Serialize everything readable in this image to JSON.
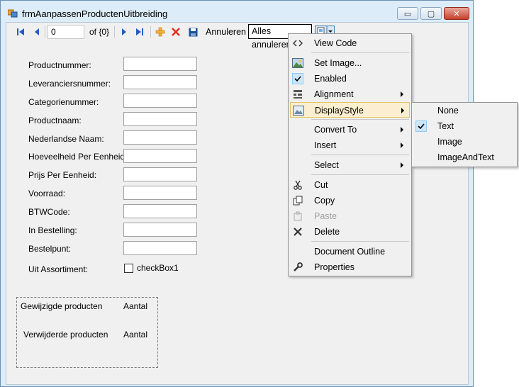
{
  "window": {
    "title": "frmAanpassenProductenUitbreiding",
    "buttons": {
      "minimize": "▭",
      "maximize": "▢",
      "close": "✕"
    }
  },
  "toolstrip": {
    "position_value": "0",
    "count_label": "of {0}",
    "cancel_label": "Annuleren",
    "cancel_all_label": "Alles annuleren",
    "icons": [
      "move-first-icon",
      "move-previous-icon",
      "move-next-icon",
      "move-last-icon",
      "add-new-icon",
      "delete-icon",
      "save-icon",
      "split-button-icon"
    ]
  },
  "form": {
    "fields": [
      {
        "label": "Productnummer:",
        "value": ""
      },
      {
        "label": "Leveranciersnummer:",
        "value": ""
      },
      {
        "label": "Categorienummer:",
        "value": ""
      },
      {
        "label": "Productnaam:",
        "value": ""
      },
      {
        "label": "Nederlandse Naam:",
        "value": ""
      },
      {
        "label": "Hoeveelheid Per Eenheid:",
        "value": ""
      },
      {
        "label": "Prijs Per Eenheid:",
        "value": ""
      },
      {
        "label": "Voorraad:",
        "value": ""
      },
      {
        "label": "BTWCode:",
        "value": ""
      },
      {
        "label": "In Bestelling:",
        "value": ""
      },
      {
        "label": "Bestelpunt:",
        "value": ""
      }
    ],
    "assortiment_label": "Uit Assortiment:",
    "checkbox_label": "checkBox1",
    "checkbox_checked": false
  },
  "groupbox": {
    "row1_label": "Gewijzigde producten",
    "row1_value": "Aantal",
    "row2_label": "Verwijderde producten",
    "row2_value": "Aantal"
  },
  "context_menu": {
    "items": [
      {
        "label": "View Code",
        "icon": "view-code-icon"
      },
      {
        "label": "Set Image...",
        "icon": "image-icon"
      },
      {
        "label": "Enabled",
        "icon": "checkmark-icon",
        "checked": true
      },
      {
        "label": "Alignment",
        "icon": "alignment-icon",
        "submenu": true
      },
      {
        "label": "DisplayStyle",
        "icon": "display-style-icon",
        "submenu": true,
        "highlighted": true
      },
      {
        "label": "Convert To",
        "submenu": true
      },
      {
        "label": "Insert",
        "submenu": true
      },
      {
        "label": "Select",
        "submenu": true
      },
      {
        "label": "Cut",
        "icon": "cut-icon"
      },
      {
        "label": "Copy",
        "icon": "copy-icon"
      },
      {
        "label": "Paste",
        "icon": "paste-icon",
        "disabled": true
      },
      {
        "label": "Delete",
        "icon": "delete-icon"
      },
      {
        "label": "Document Outline"
      },
      {
        "label": "Properties",
        "icon": "wrench-icon"
      }
    ]
  },
  "submenu": {
    "items": [
      {
        "label": "None"
      },
      {
        "label": "Text",
        "checked": true
      },
      {
        "label": "Image"
      },
      {
        "label": "ImageAndText"
      }
    ]
  },
  "colors": {
    "title_bar": "#dcecf8",
    "highlight": "#fcefd1",
    "close_button": "#c7402c"
  }
}
